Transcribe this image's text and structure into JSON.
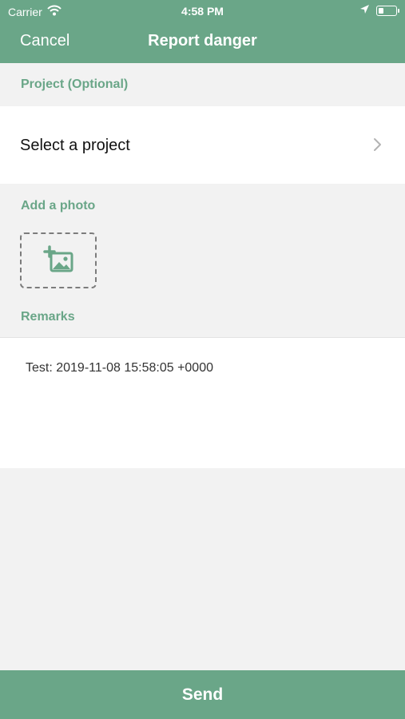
{
  "status_bar": {
    "carrier": "Carrier",
    "time": "4:58 PM"
  },
  "nav": {
    "cancel_label": "Cancel",
    "title": "Report danger"
  },
  "project": {
    "section_label": "Project (Optional)",
    "row_label": "Select a project"
  },
  "photo": {
    "section_label": "Add a photo"
  },
  "remarks": {
    "section_label": "Remarks",
    "value": "Test: 2019-11-08 15:58:05 +0000"
  },
  "footer": {
    "send_label": "Send"
  },
  "colors": {
    "accent": "#6aa688",
    "background": "#f2f2f2",
    "surface": "#ffffff"
  }
}
